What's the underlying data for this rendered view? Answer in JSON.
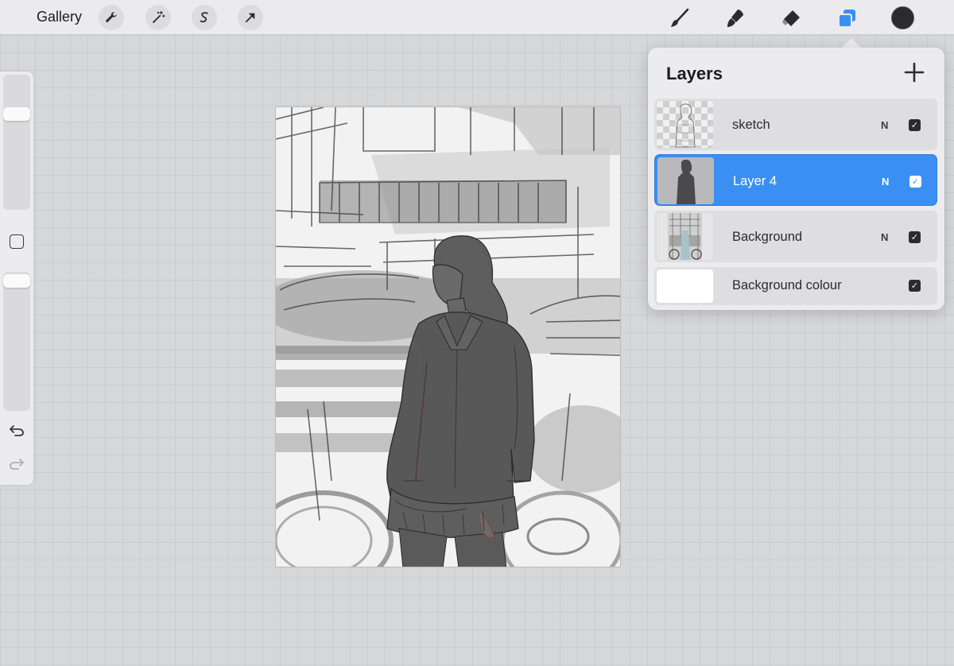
{
  "toolbar": {
    "gallery_label": "Gallery",
    "left_tools": [
      "wrench-icon",
      "magic-wand-icon",
      "selection-s-icon",
      "transform-arrow-icon"
    ],
    "right_tools": [
      "brush-icon",
      "smudge-icon",
      "eraser-icon",
      "layers-icon"
    ],
    "active_tool": "layers-icon",
    "active_color": "#2b2b2d",
    "accent_color": "#3b8ff2"
  },
  "sidebar": {
    "brush_size_level": 0.27,
    "opacity_level": 0.02
  },
  "layers": {
    "title": "Layers",
    "items": [
      {
        "name": "sketch",
        "mode": "N",
        "visible": true,
        "active": false
      },
      {
        "name": "Layer 4",
        "mode": "N",
        "visible": true,
        "active": true
      },
      {
        "name": "Background",
        "mode": "N",
        "visible": true,
        "active": false
      },
      {
        "name": "Background colour",
        "mode": "",
        "visible": true,
        "active": false
      }
    ]
  }
}
